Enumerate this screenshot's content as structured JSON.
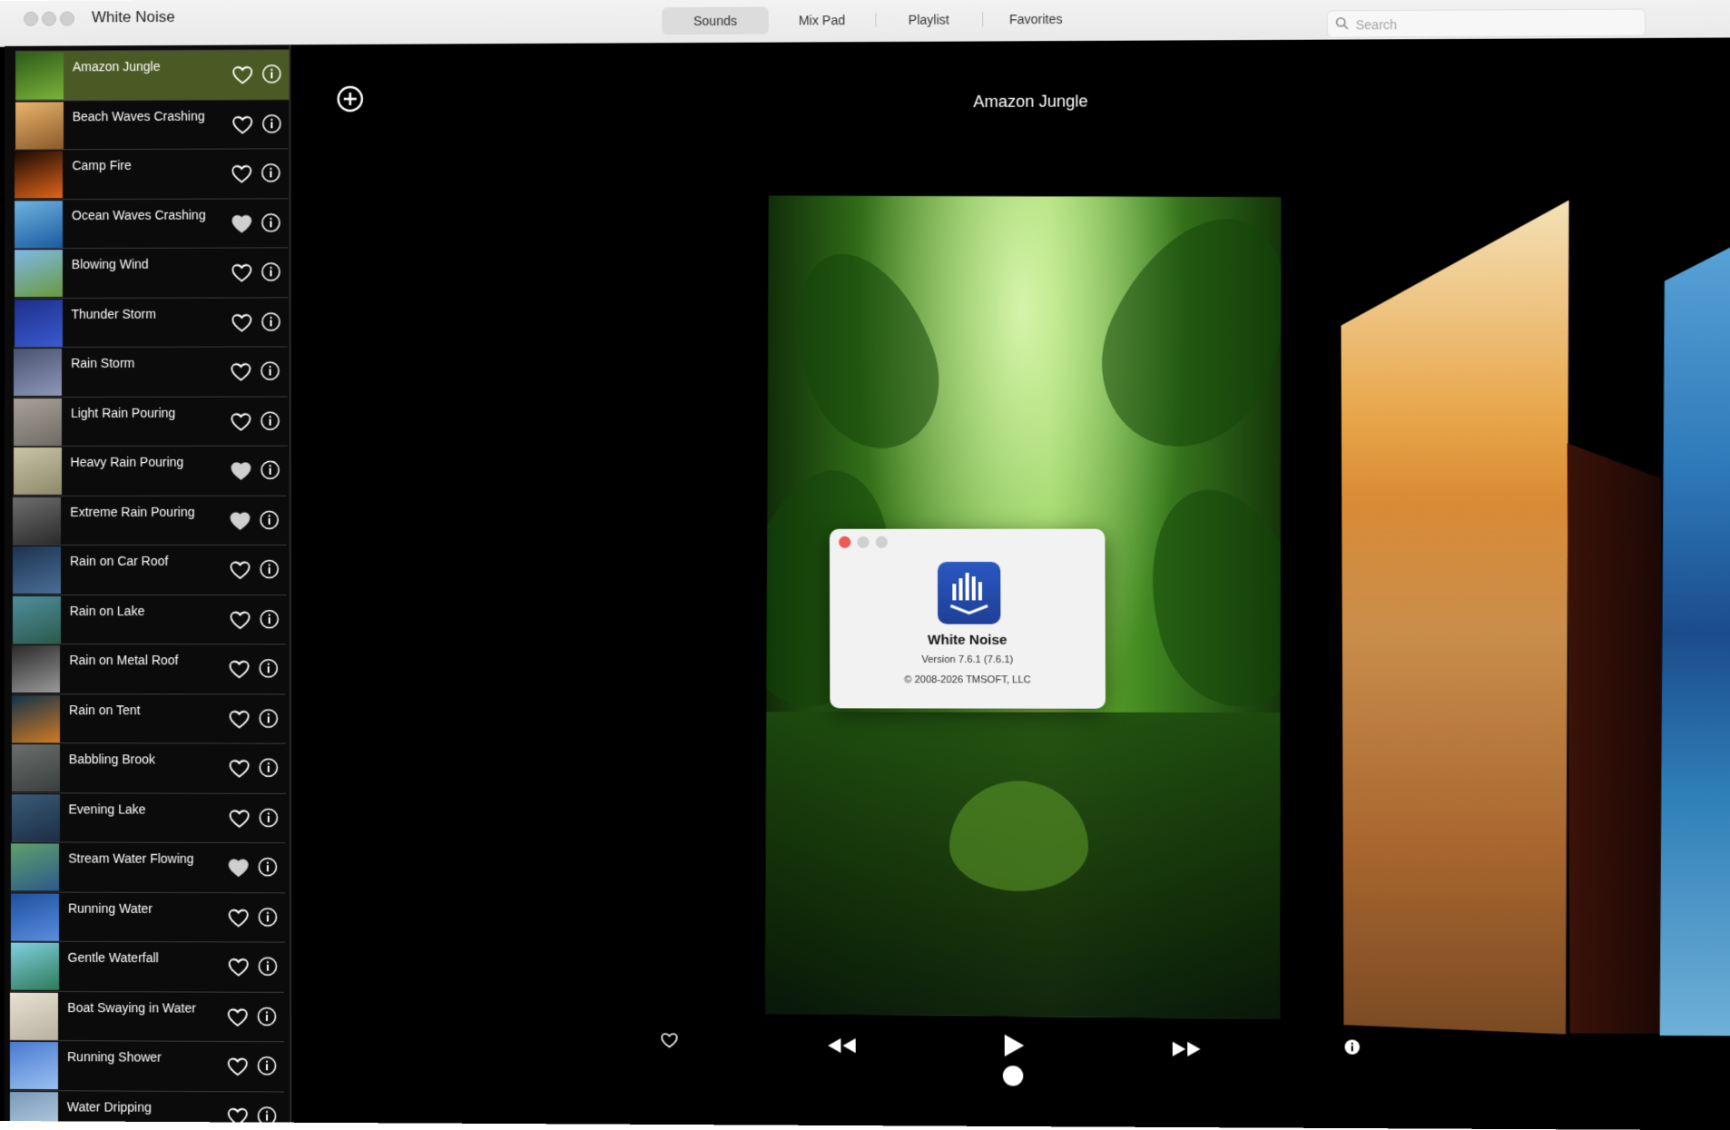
{
  "app": {
    "title": "White Noise"
  },
  "tabs": [
    {
      "label": "Sounds",
      "active": true
    },
    {
      "label": "Mix Pad",
      "active": false
    },
    {
      "label": "Playlist",
      "active": false
    },
    {
      "label": "Favorites",
      "active": false
    }
  ],
  "search": {
    "placeholder": "Search",
    "value": ""
  },
  "sidebar": {
    "items": [
      {
        "label": "Amazon Jungle",
        "selected": true,
        "favorite": false,
        "thumb": [
          "#2e5a18",
          "#79b33b"
        ]
      },
      {
        "label": "Beach Waves Crashing",
        "selected": false,
        "favorite": false,
        "thumb": [
          "#e9b46b",
          "#8a5a2b"
        ]
      },
      {
        "label": "Camp Fire",
        "selected": false,
        "favorite": false,
        "thumb": [
          "#1a0a02",
          "#e0651a"
        ]
      },
      {
        "label": "Ocean Waves Crashing",
        "selected": false,
        "favorite": true,
        "thumb": [
          "#6fb4e0",
          "#1a5aa0"
        ]
      },
      {
        "label": "Blowing Wind",
        "selected": false,
        "favorite": false,
        "thumb": [
          "#7fb8ea",
          "#6a9a3a"
        ]
      },
      {
        "label": "Thunder Storm",
        "selected": false,
        "favorite": false,
        "thumb": [
          "#1d2f8a",
          "#3b5ad0"
        ]
      },
      {
        "label": "Rain Storm",
        "selected": false,
        "favorite": false,
        "thumb": [
          "#4a5270",
          "#8e97b8"
        ]
      },
      {
        "label": "Light Rain Pouring",
        "selected": false,
        "favorite": false,
        "thumb": [
          "#a9a29a",
          "#6f6a64"
        ]
      },
      {
        "label": "Heavy Rain Pouring",
        "selected": false,
        "favorite": true,
        "thumb": [
          "#c9c3a8",
          "#8d8a6a"
        ]
      },
      {
        "label": "Extreme Rain Pouring",
        "selected": false,
        "favorite": true,
        "thumb": [
          "#6e6e6e",
          "#2a2a2a"
        ]
      },
      {
        "label": "Rain on Car Roof",
        "selected": false,
        "favorite": false,
        "thumb": [
          "#1c3350",
          "#4a6e96"
        ]
      },
      {
        "label": "Rain on Lake",
        "selected": false,
        "favorite": false,
        "thumb": [
          "#4f8ea0",
          "#2b5a4a"
        ]
      },
      {
        "label": "Rain on Metal Roof",
        "selected": false,
        "favorite": false,
        "thumb": [
          "#2a2a2a",
          "#9a9a9a"
        ]
      },
      {
        "label": "Rain on Tent",
        "selected": false,
        "favorite": false,
        "thumb": [
          "#12324a",
          "#d07a22"
        ]
      },
      {
        "label": "Babbling Brook",
        "selected": false,
        "favorite": false,
        "thumb": [
          "#6a6e6c",
          "#3a3e3c"
        ]
      },
      {
        "label": "Evening Lake",
        "selected": false,
        "favorite": false,
        "thumb": [
          "#3a5a78",
          "#1c2e44"
        ]
      },
      {
        "label": "Stream Water Flowing",
        "selected": false,
        "favorite": true,
        "thumb": [
          "#5fa06a",
          "#2b5a8a"
        ]
      },
      {
        "label": "Running Water",
        "selected": false,
        "favorite": false,
        "thumb": [
          "#1e4fa0",
          "#5a8ee0"
        ]
      },
      {
        "label": "Gentle Waterfall",
        "selected": false,
        "favorite": false,
        "thumb": [
          "#7fd0e0",
          "#2e7a5a"
        ]
      },
      {
        "label": "Boat Swaying in Water",
        "selected": false,
        "favorite": false,
        "thumb": [
          "#e8e2d2",
          "#b8b0a0"
        ]
      },
      {
        "label": "Running Shower",
        "selected": false,
        "favorite": false,
        "thumb": [
          "#4a7ad0",
          "#9ac0f0"
        ]
      },
      {
        "label": "Water Dripping",
        "selected": false,
        "favorite": false,
        "thumb": [
          "#7a9ab8",
          "#c0d4e8"
        ]
      }
    ]
  },
  "player": {
    "now_playing": "Amazon Jungle"
  },
  "about": {
    "name": "White Noise",
    "version": "Version 7.6.1 (7.6.1)",
    "copyright": "© 2008-2026 TMSOFT, LLC"
  },
  "icons": {
    "add": "plus-circle-icon",
    "favorite": "heart-icon",
    "info": "info-circle-icon",
    "rewind": "rewind-icon",
    "play": "play-icon",
    "forward": "fast-forward-icon"
  },
  "colors": {
    "selected_row": "#4b5a25",
    "titlebar": "#ececec",
    "background": "#000000",
    "about_icon": "#1e3f97"
  }
}
